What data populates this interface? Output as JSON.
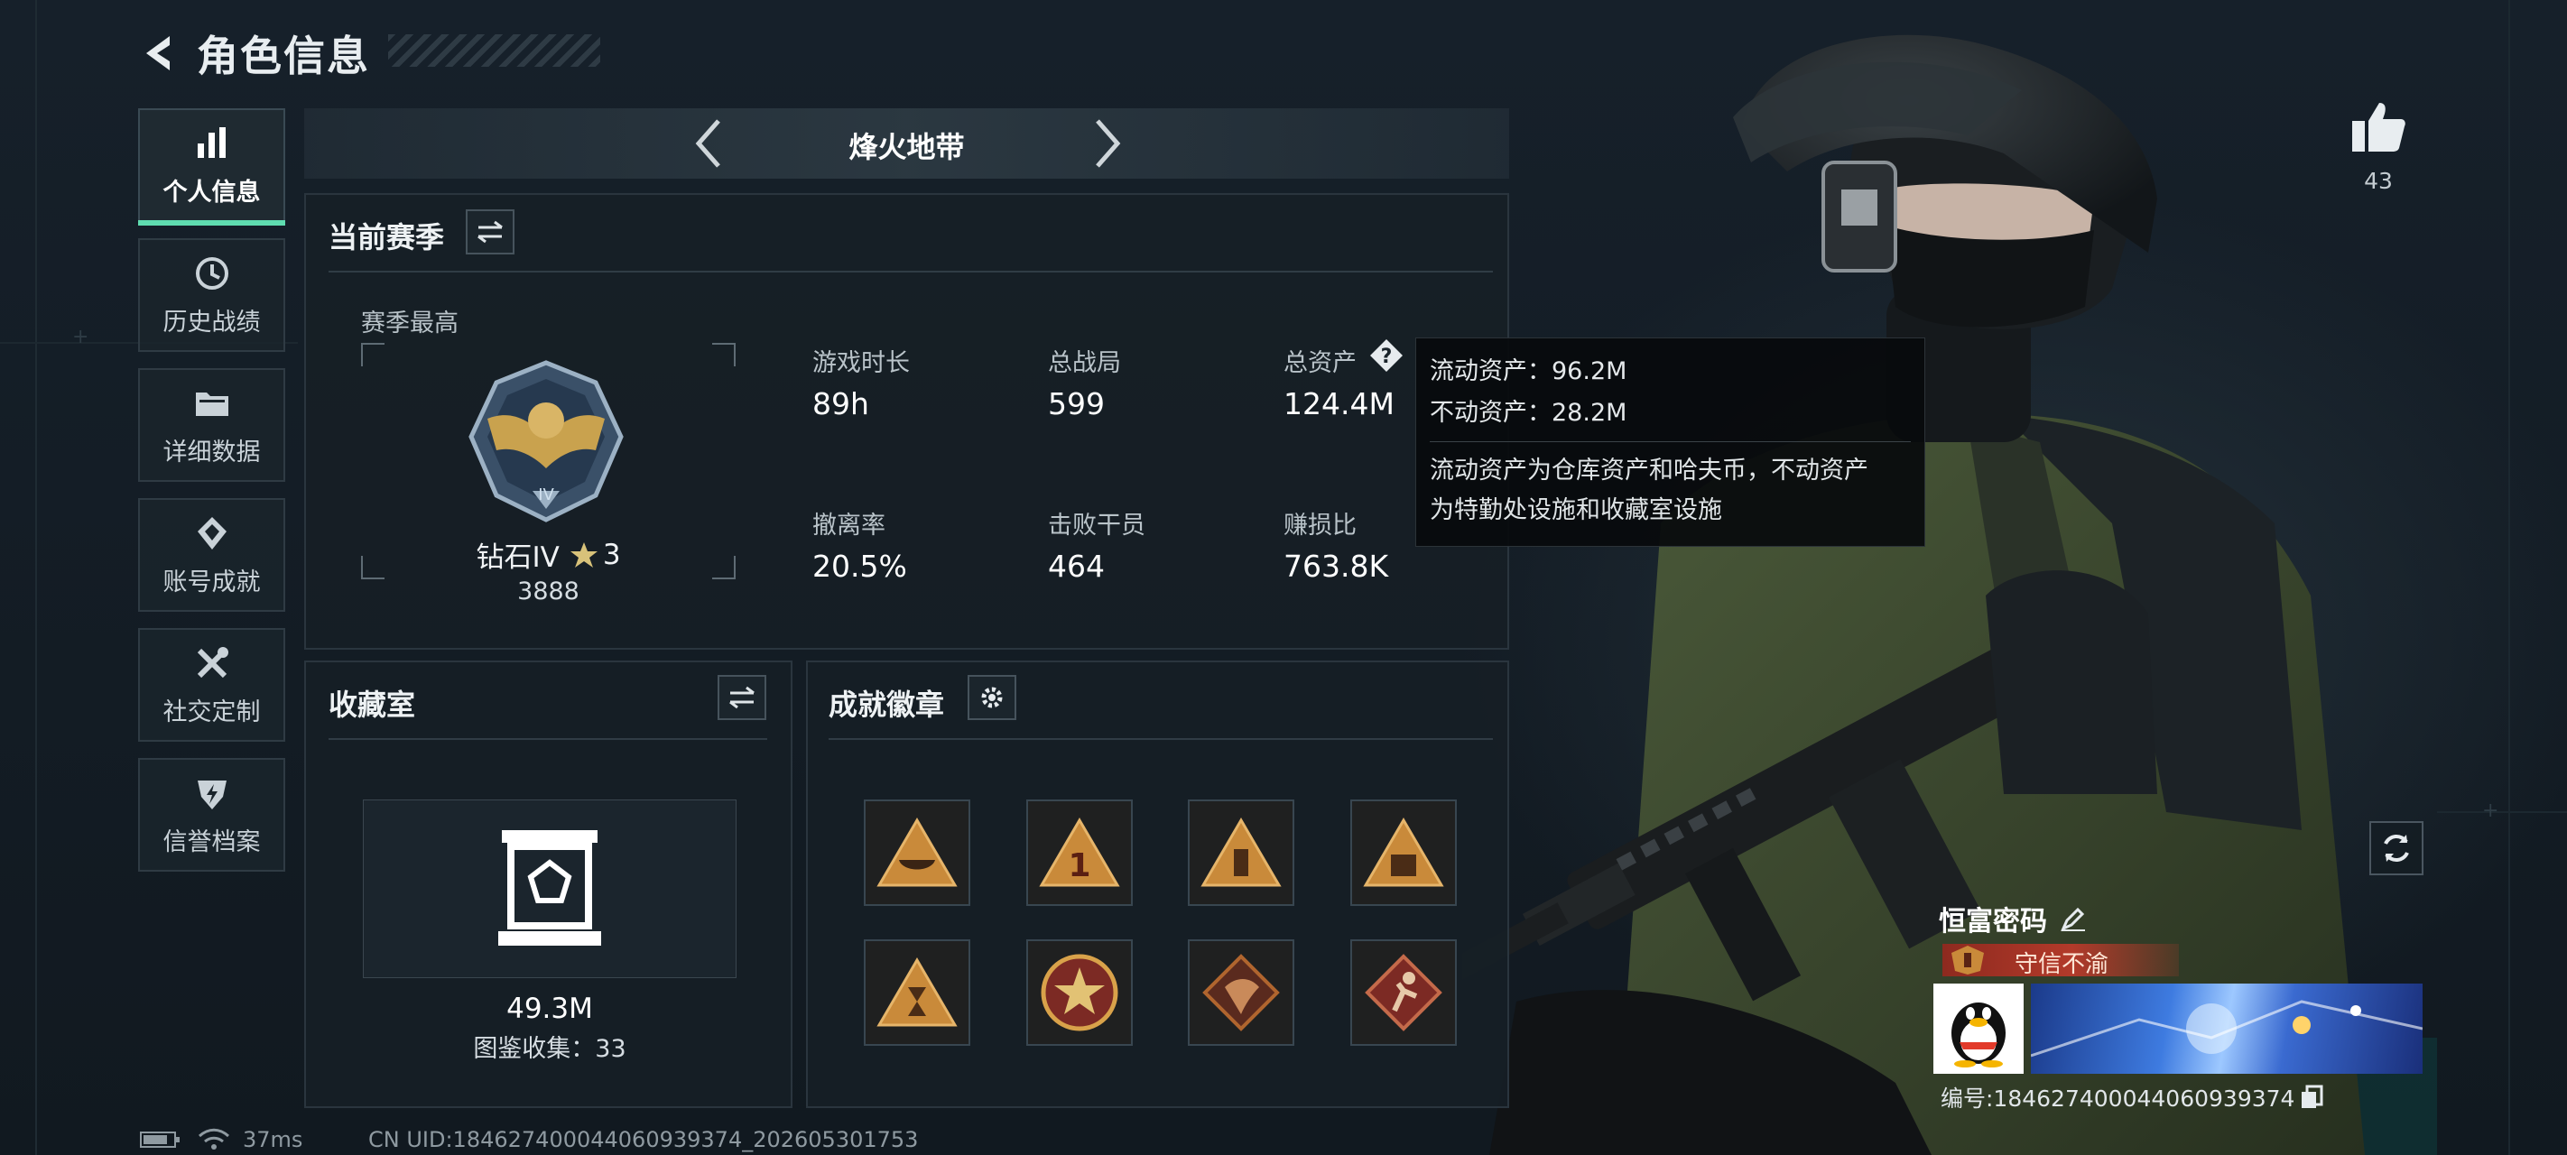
{
  "header": {
    "title": "角色信息"
  },
  "sidebar": {
    "items": [
      {
        "label": "个人信息",
        "icon": "bar-chart-icon",
        "active": true
      },
      {
        "label": "历史战绩",
        "icon": "history-icon"
      },
      {
        "label": "详细数据",
        "icon": "folder-icon"
      },
      {
        "label": "账号成就",
        "icon": "achievement-icon"
      },
      {
        "label": "社交定制",
        "icon": "tools-icon"
      },
      {
        "label": "信誉档案",
        "icon": "shield-bolt-icon"
      }
    ]
  },
  "mode": {
    "title": "烽火地带"
  },
  "season": {
    "title": "当前赛季",
    "best_label": "赛季最高",
    "rank_name": "钻石IV",
    "stars": "3",
    "rank_score": "3888",
    "stats": [
      {
        "label": "游戏时长",
        "value": "89h"
      },
      {
        "label": "总战局",
        "value": "599"
      },
      {
        "label": "总资产",
        "value": "124.4M"
      },
      {
        "label": "撤离率",
        "value": "20.5%"
      },
      {
        "label": "击败干员",
        "value": "464"
      },
      {
        "label": "赚损比",
        "value": "763.8K"
      }
    ]
  },
  "tooltip": {
    "liquid": "流动资产：96.2M",
    "fixed": "不动资产：28.2M",
    "desc_line1": "流动资产为仓库资产和哈夫币，不动资产",
    "desc_line2": "为特勤处设施和收藏室设施"
  },
  "collection": {
    "title": "收藏室",
    "value": "49.3M",
    "count_text": "图鉴收集：33"
  },
  "badges": {
    "title": "成就徽章",
    "items": [
      "bowl-badge-icon",
      "number-one-badge-icon",
      "bottle-badge-icon",
      "crate-badge-icon",
      "hourglass-badge-icon",
      "star-emblem-badge-icon",
      "dragon-badge-icon",
      "runner-badge-icon"
    ]
  },
  "like": {
    "count": "43"
  },
  "player": {
    "name": "恒富密码",
    "honor": "守信不渝",
    "id_text": "编号:184627400044060939374"
  },
  "status": {
    "ping": "37ms",
    "uid": "CN UID:184627400044060939374_202605301753"
  },
  "colors": {
    "accent": "#5fdcb0",
    "honor": "#b23a2a",
    "badge_gold": "#d9a24a"
  }
}
